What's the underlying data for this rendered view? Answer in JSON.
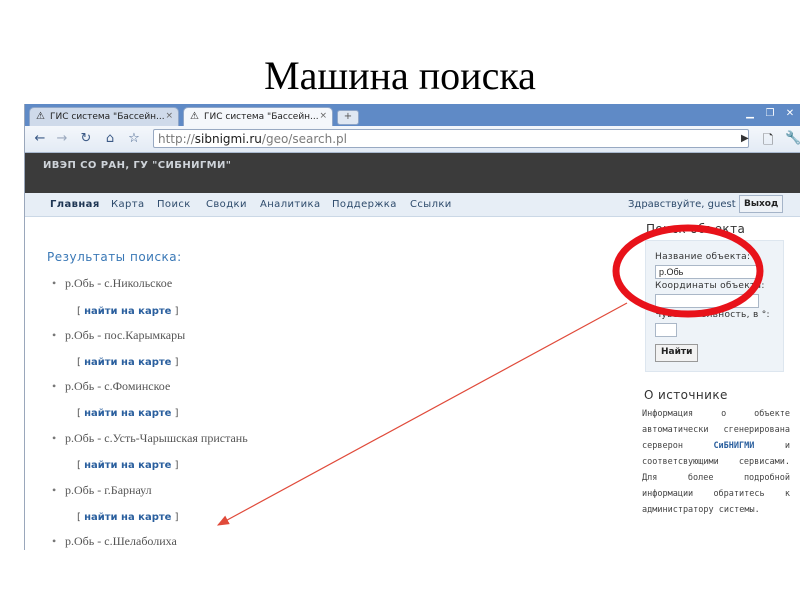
{
  "slide": {
    "title": "Машина поиска"
  },
  "browser": {
    "tabs": [
      {
        "label": "ГИС система \"Бассейн...",
        "close": "×"
      },
      {
        "label": "ГИС система \"Бассейн...",
        "close": "×"
      }
    ],
    "new_tab": "+",
    "address": {
      "scheme": "http://",
      "domain": "sibnigmi.ru",
      "path": "/geo/search.pl"
    }
  },
  "site": {
    "org": "ИВЭП СО РАН, ГУ \"СИБНИГМИ\"",
    "menu": [
      "Главная",
      "Карта",
      "Поиск",
      "Сводки",
      "Аналитика",
      "Поддержка",
      "Ссылки"
    ],
    "greeting": "Здравствуйте, guest",
    "logout": "Выход"
  },
  "results": {
    "title": "Результаты поиска:",
    "items": [
      "р.Обь - с.Никольское",
      "р.Обь - пос.Карымкары",
      "р.Обь - с.Фоминское",
      "р.Обь - с.Усть-Чарышская пристань",
      "р.Обь - г.Барнаул",
      "р.Обь - с.Шелаболиха"
    ],
    "link_open": "[",
    "link_text": "найти на карте",
    "link_close": "]"
  },
  "search_panel": {
    "title": "Поиск объекта",
    "name_label": "Название объекта:",
    "name_value": "р.Обь",
    "coords_label": "Координаты объекта:",
    "coords_value": "",
    "sens_label": "Чувствительность, в °:",
    "sens_value": "",
    "button": "Найти"
  },
  "about": {
    "title": "О источнике",
    "text_before": "Информация о объекте автоматически сгенерирована серверон ",
    "brand": "СиБНИГМИ",
    "text_after": " и соответсвующими сервисами. Для более подробной информации обратитесь к администратору системы."
  },
  "annotation": {
    "circle_color": "#e8121a",
    "arrow_color": "#e04a3a"
  }
}
